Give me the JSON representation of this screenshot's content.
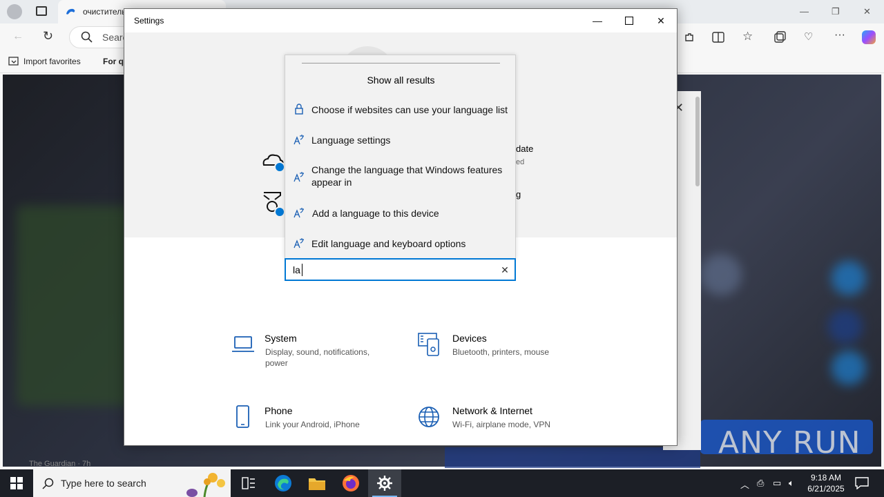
{
  "browser": {
    "tab_title": "очиститель",
    "search_placeholder": "Searc",
    "favorites": [
      "Import favorites",
      "For qu"
    ],
    "news_source": "The Guardian · 7h",
    "watermark": "ANY RUN"
  },
  "settings": {
    "window_title": "Settings",
    "header_items": [
      {
        "title": "date",
        "sub": "ed"
      },
      {
        "title": "g",
        "sub": ""
      }
    ],
    "search": {
      "value": "la"
    },
    "dropdown": {
      "show_all": "Show all results",
      "items": [
        {
          "label": "Choose if websites can use your language list",
          "icon": "lock-icon"
        },
        {
          "label": "Language settings",
          "icon": "language-icon"
        },
        {
          "label": "Change the language that Windows features appear in",
          "icon": "language-icon"
        },
        {
          "label": "Add a language to this device",
          "icon": "language-icon"
        },
        {
          "label": "Edit language and keyboard options",
          "icon": "language-icon"
        }
      ]
    },
    "categories": [
      {
        "title": "System",
        "desc": "Display, sound, notifications, power",
        "icon": "laptop-icon"
      },
      {
        "title": "Devices",
        "desc": "Bluetooth, printers, mouse",
        "icon": "devices-icon"
      },
      {
        "title": "Phone",
        "desc": "Link your Android, iPhone",
        "icon": "phone-icon"
      },
      {
        "title": "Network & Internet",
        "desc": "Wi-Fi, airplane mode, VPN",
        "icon": "globe-icon"
      }
    ]
  },
  "taskbar": {
    "search_placeholder": "Type here to search",
    "time": "9:18 AM",
    "date": "6/21/2025"
  },
  "colors": {
    "accent": "#0078d4",
    "taskbar": "#1c1f26"
  }
}
